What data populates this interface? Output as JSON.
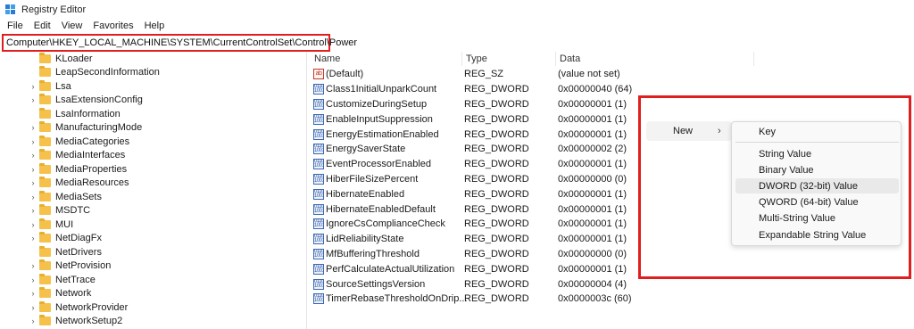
{
  "window": {
    "title": "Registry Editor"
  },
  "menu": [
    "File",
    "Edit",
    "View",
    "Favorites",
    "Help"
  ],
  "address": {
    "path": "Computer\\HKEY_LOCAL_MACHINE\\SYSTEM\\CurrentControlSet\\Control\\Power"
  },
  "tree": [
    {
      "label": "KLoader",
      "expandable": false
    },
    {
      "label": "LeapSecondInformation",
      "expandable": false
    },
    {
      "label": "Lsa",
      "expandable": true
    },
    {
      "label": "LsaExtensionConfig",
      "expandable": true
    },
    {
      "label": "LsaInformation",
      "expandable": false
    },
    {
      "label": "ManufacturingMode",
      "expandable": true
    },
    {
      "label": "MediaCategories",
      "expandable": true
    },
    {
      "label": "MediaInterfaces",
      "expandable": true
    },
    {
      "label": "MediaProperties",
      "expandable": true
    },
    {
      "label": "MediaResources",
      "expandable": true
    },
    {
      "label": "MediaSets",
      "expandable": true
    },
    {
      "label": "MSDTC",
      "expandable": true
    },
    {
      "label": "MUI",
      "expandable": true
    },
    {
      "label": "NetDiagFx",
      "expandable": true
    },
    {
      "label": "NetDrivers",
      "expandable": false
    },
    {
      "label": "NetProvision",
      "expandable": true
    },
    {
      "label": "NetTrace",
      "expandable": true
    },
    {
      "label": "Network",
      "expandable": true
    },
    {
      "label": "NetworkProvider",
      "expandable": true
    },
    {
      "label": "NetworkSetup2",
      "expandable": true
    }
  ],
  "columns": {
    "name": "Name",
    "type": "Type",
    "data": "Data"
  },
  "values": [
    {
      "name": "(Default)",
      "type": "REG_SZ",
      "data": "(value not set)",
      "icon": "string-value-icon"
    },
    {
      "name": "Class1InitialUnparkCount",
      "type": "REG_DWORD",
      "data": "0x00000040 (64)",
      "icon": "binary-value-icon"
    },
    {
      "name": "CustomizeDuringSetup",
      "type": "REG_DWORD",
      "data": "0x00000001 (1)",
      "icon": "binary-value-icon"
    },
    {
      "name": "EnableInputSuppression",
      "type": "REG_DWORD",
      "data": "0x00000001 (1)",
      "icon": "binary-value-icon"
    },
    {
      "name": "EnergyEstimationEnabled",
      "type": "REG_DWORD",
      "data": "0x00000001 (1)",
      "icon": "binary-value-icon"
    },
    {
      "name": "EnergySaverState",
      "type": "REG_DWORD",
      "data": "0x00000002 (2)",
      "icon": "binary-value-icon"
    },
    {
      "name": "EventProcessorEnabled",
      "type": "REG_DWORD",
      "data": "0x00000001 (1)",
      "icon": "binary-value-icon"
    },
    {
      "name": "HiberFileSizePercent",
      "type": "REG_DWORD",
      "data": "0x00000000 (0)",
      "icon": "binary-value-icon"
    },
    {
      "name": "HibernateEnabled",
      "type": "REG_DWORD",
      "data": "0x00000001 (1)",
      "icon": "binary-value-icon"
    },
    {
      "name": "HibernateEnabledDefault",
      "type": "REG_DWORD",
      "data": "0x00000001 (1)",
      "icon": "binary-value-icon"
    },
    {
      "name": "IgnoreCsComplianceCheck",
      "type": "REG_DWORD",
      "data": "0x00000001 (1)",
      "icon": "binary-value-icon"
    },
    {
      "name": "LidReliabilityState",
      "type": "REG_DWORD",
      "data": "0x00000001 (1)",
      "icon": "binary-value-icon"
    },
    {
      "name": "MfBufferingThreshold",
      "type": "REG_DWORD",
      "data": "0x00000000 (0)",
      "icon": "binary-value-icon"
    },
    {
      "name": "PerfCalculateActualUtilization",
      "type": "REG_DWORD",
      "data": "0x00000001 (1)",
      "icon": "binary-value-icon"
    },
    {
      "name": "SourceSettingsVersion",
      "type": "REG_DWORD",
      "data": "0x00000004 (4)",
      "icon": "binary-value-icon"
    },
    {
      "name": "TimerRebaseThresholdOnDrip...",
      "type": "REG_DWORD",
      "data": "0x0000003c (60)",
      "icon": "binary-value-icon"
    }
  ],
  "context_menu": {
    "new_label": "New",
    "arrow": "›",
    "submenu": [
      {
        "label": "Key"
      },
      {
        "label": "String Value"
      },
      {
        "label": "Binary Value"
      },
      {
        "label": "DWORD (32-bit) Value",
        "hovered": true
      },
      {
        "label": "QWORD (64-bit) Value"
      },
      {
        "label": "Multi-String Value"
      },
      {
        "label": "Expandable String Value"
      }
    ]
  },
  "colors": {
    "highlight": "#e01e1e",
    "folder": "#f5c14a",
    "dword_icon": "#3967b3"
  }
}
